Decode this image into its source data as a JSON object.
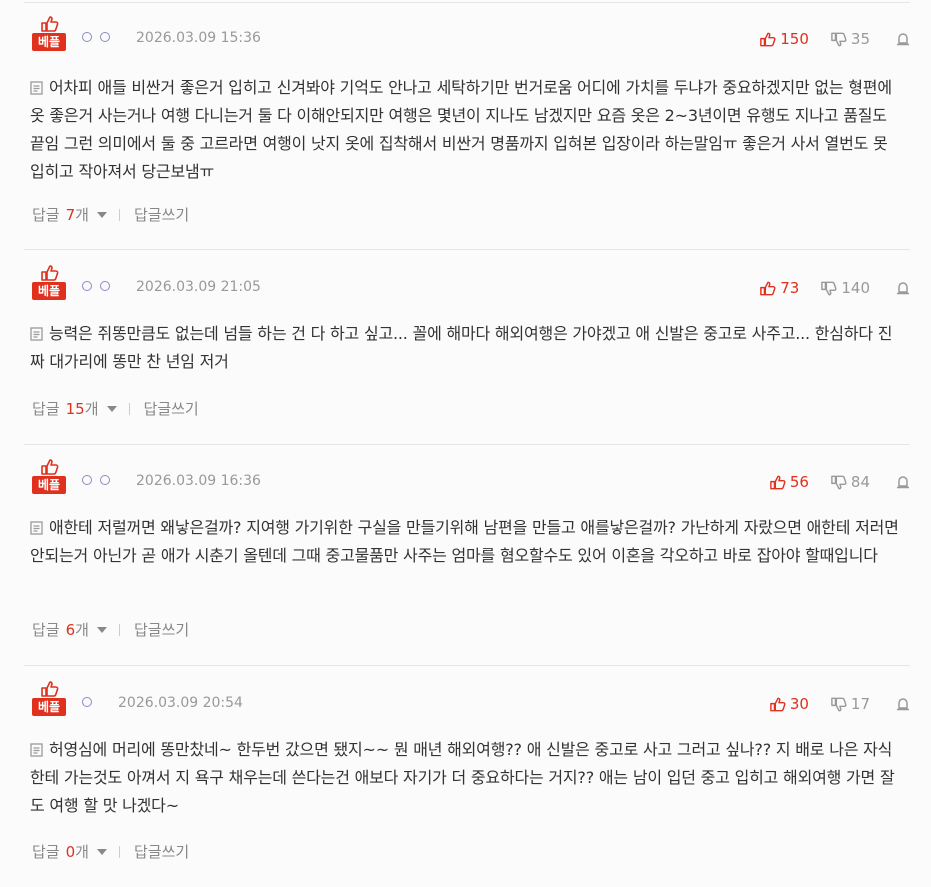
{
  "colors": {
    "accent_red": "#e0301e",
    "text": "#333333",
    "muted": "#999999",
    "divider": "#e6e6e6"
  },
  "best_badge_label": "베플",
  "reply_label": "답글",
  "reply_count_unit": "개",
  "write_reply_label": "답글쓰기",
  "comments": [
    {
      "dots": 2,
      "date": "2026.03.09 15:36",
      "likes": "150",
      "dislikes": "35",
      "text": "어차피 애들 비싼거 좋은거 입히고 신겨봐야 기억도 안나고 세탁하기만 번거로움 어디에 가치를 두냐가 중요하겠지만 없는 형편에 옷 좋은거 사는거나 여행 다니는거 둘 다 이해안되지만 여행은 몇년이 지나도 남겠지만 요즘 옷은 2~3년이면 유행도 지나고 품질도 끝임 그런 의미에서 둘 중 고르라면 여행이 낫지 옷에 집착해서 비싼거 명품까지 입혀본 입장이라 하는말임ㅠ 좋은거 사서 열번도 못 입히고 작아져서 당근보냄ㅠ",
      "reply_count": "7"
    },
    {
      "dots": 2,
      "date": "2026.03.09 21:05",
      "likes": "73",
      "dislikes": "140",
      "text": "능력은 쥐똥만큼도 없는데 넘들 하는 건 다 하고 싶고... 꼴에 해마다 해외여행은 가야겠고 애 신발은 중고로 사주고... 한심하다 진짜 대가리에 똥만 찬 년임 저거",
      "reply_count": "15"
    },
    {
      "dots": 2,
      "date": "2026.03.09 16:36",
      "likes": "56",
      "dislikes": "84",
      "text": "애한테 저럴꺼면 왜낳은걸까? 지여행 가기위한 구실을 만들기위해 남편을 만들고 애를낳은걸까? 가난하게 자랐으면 애한테 저러면 안되는거 아닌가 곧 애가 시춘기 올텐데 그때 중고물품만 사주는 엄마를 혐오할수도 있어 이혼을 각오하고 바로 잡아야 할때입니다",
      "reply_count": "6"
    },
    {
      "dots": 1,
      "date": "2026.03.09 20:54",
      "likes": "30",
      "dislikes": "17",
      "text": "허영심에 머리에 똥만찼네~ 한두번 갔으면 됐지~~ 뭔 매년 해외여행?? 애 신발은 중고로 사고 그러고 싶나?? 지 배로 나은 자식한테 가는것도 아껴서 지 욕구 채우는데 쓴다는건 애보다 자기가 더 중요하다는 거지?? 애는 남이 입던 중고 입히고 해외여행 가면 잘도 여행 할 맛 나겠다~",
      "reply_count": "0"
    }
  ]
}
